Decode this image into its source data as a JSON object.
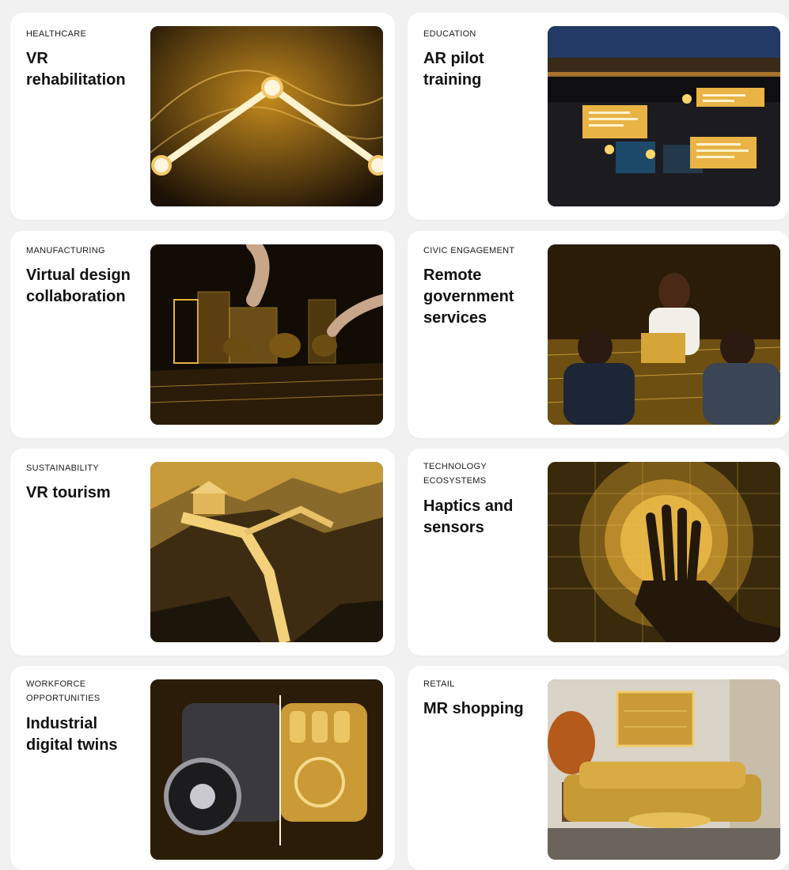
{
  "cards": [
    {
      "category": "HEALTHCARE",
      "title": "VR rehabilitation",
      "image": "glowing-arm-joint-tracking"
    },
    {
      "category": "EDUCATION",
      "title": "AR pilot training",
      "image": "cockpit-ar-overlay"
    },
    {
      "category": "MANUFACTURING",
      "title": "Virtual design collaboration",
      "image": "holographic-city-model"
    },
    {
      "category": "CIVIC ENGAGEMENT",
      "title": "Remote government services",
      "image": "virtual-meeting-table"
    },
    {
      "category": "SUSTAINABILITY",
      "title": "VR tourism",
      "image": "great-wall-landscape"
    },
    {
      "category": "TECHNOLOGY ECOSYSTEMS",
      "title": "Haptics and sensors",
      "image": "hand-touching-sensor-field"
    },
    {
      "category": "WORKFORCE OPPORTUNITIES",
      "title": "Industrial digital twins",
      "image": "engine-digital-twin"
    },
    {
      "category": "RETAIL",
      "title": "MR shopping",
      "image": "living-room-ar-furniture"
    }
  ],
  "colors": {
    "gold": "#e7b33a",
    "dark": "#1a1208",
    "card": "#ffffff",
    "background": "#f1f1f2"
  }
}
